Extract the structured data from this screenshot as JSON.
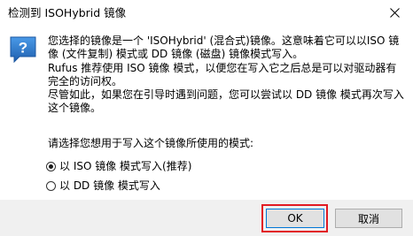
{
  "window": {
    "title": "检测到 ISOHybrid 镜像",
    "close_glyph": "✕"
  },
  "icons": {
    "dialog_icon": "question-icon",
    "close": "close-icon"
  },
  "message": {
    "lines": [
      "您选择的镜像是一个 'ISOHybrid' (混合式)镜像。这意味着它可以以ISO 镜",
      "像 (文件复制) 模式或 DD 镜像 (磁盘) 镜像模式写入。",
      "Rufus 推荐使用 ISO 镜像 模式，以便您在写入它之后总是可以对驱动器有",
      "完全的访问权。",
      "尽管如此，如果您在引导时遇到问题，您可以尝试以 DD 镜像 模式再次写入",
      "这个镜像。"
    ]
  },
  "prompt": "请选择您想用于写入这个镜像所使用的模式:",
  "options": [
    {
      "label": "以 ISO 镜像 模式写入(推荐)",
      "selected": true
    },
    {
      "label": "以 DD 镜像 模式写入",
      "selected": false
    }
  ],
  "buttons": {
    "ok_label": "OK",
    "cancel_label": "取消"
  },
  "colors": {
    "highlight": "#e21b23",
    "accent": "#0078d7",
    "icon_blue": "#1e6fc7",
    "footer_bg": "#f0f0f0"
  }
}
